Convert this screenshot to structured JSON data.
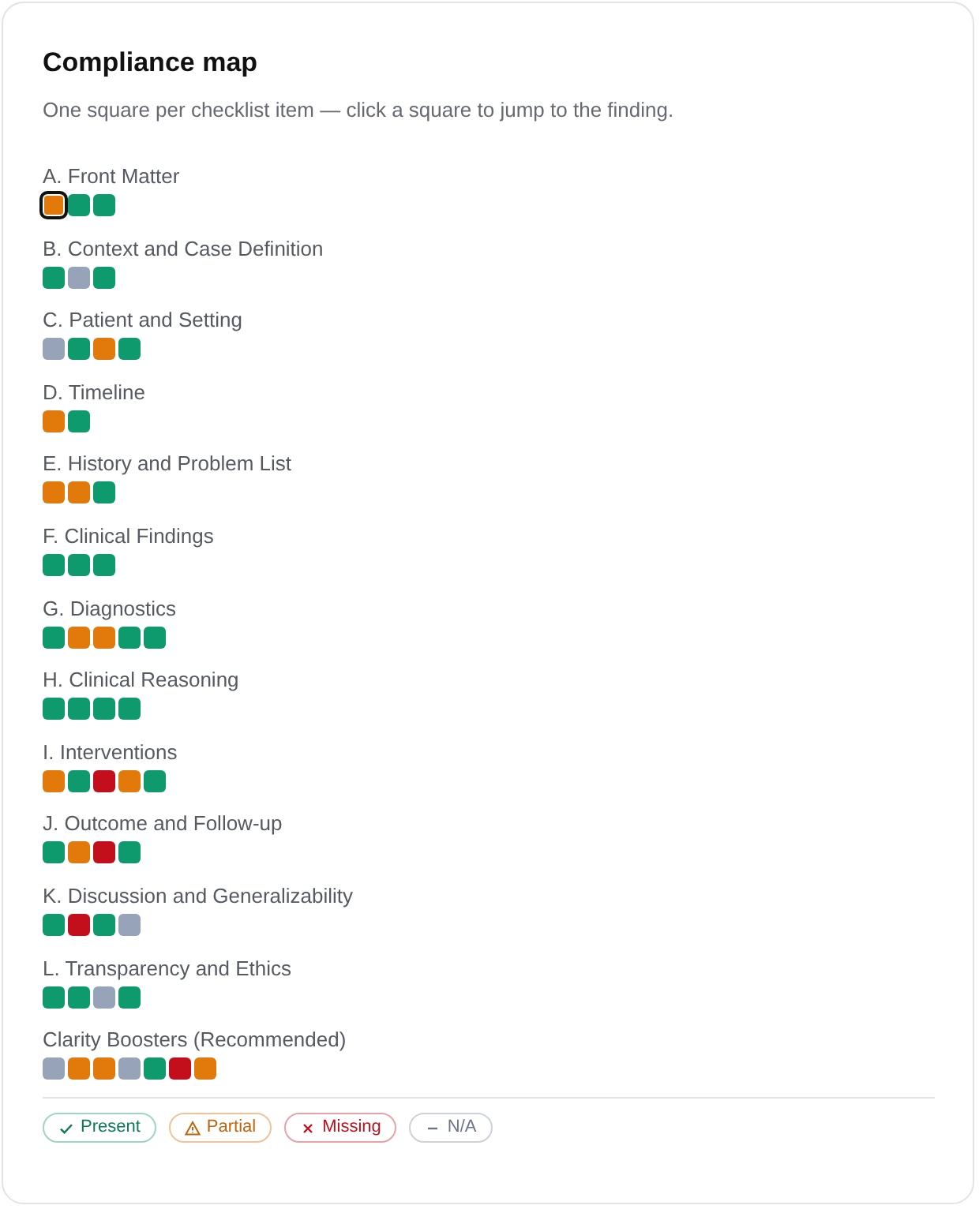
{
  "title": "Compliance map",
  "subtitle": "One square per checklist item — click a square to jump to the finding.",
  "sections": [
    {
      "label": "A. Front Matter",
      "squares": [
        {
          "kind": "partial",
          "selected": true
        },
        {
          "kind": "present",
          "selected": false
        },
        {
          "kind": "present",
          "selected": false
        }
      ]
    },
    {
      "label": "B. Context and Case Definition",
      "squares": [
        {
          "kind": "present",
          "selected": false
        },
        {
          "kind": "na",
          "selected": false
        },
        {
          "kind": "present",
          "selected": false
        }
      ]
    },
    {
      "label": "C. Patient and Setting",
      "squares": [
        {
          "kind": "na",
          "selected": false
        },
        {
          "kind": "present",
          "selected": false
        },
        {
          "kind": "partial",
          "selected": false
        },
        {
          "kind": "present",
          "selected": false
        }
      ]
    },
    {
      "label": "D. Timeline",
      "squares": [
        {
          "kind": "partial",
          "selected": false
        },
        {
          "kind": "present",
          "selected": false
        }
      ]
    },
    {
      "label": "E. History and Problem List",
      "squares": [
        {
          "kind": "partial",
          "selected": false
        },
        {
          "kind": "partial",
          "selected": false
        },
        {
          "kind": "present",
          "selected": false
        }
      ]
    },
    {
      "label": "F. Clinical Findings",
      "squares": [
        {
          "kind": "present",
          "selected": false
        },
        {
          "kind": "present",
          "selected": false
        },
        {
          "kind": "present",
          "selected": false
        }
      ]
    },
    {
      "label": "G. Diagnostics",
      "squares": [
        {
          "kind": "present",
          "selected": false
        },
        {
          "kind": "partial",
          "selected": false
        },
        {
          "kind": "partial",
          "selected": false
        },
        {
          "kind": "present",
          "selected": false
        },
        {
          "kind": "present",
          "selected": false
        }
      ]
    },
    {
      "label": "H. Clinical Reasoning",
      "squares": [
        {
          "kind": "present",
          "selected": false
        },
        {
          "kind": "present",
          "selected": false
        },
        {
          "kind": "present",
          "selected": false
        },
        {
          "kind": "present",
          "selected": false
        }
      ]
    },
    {
      "label": "I. Interventions",
      "squares": [
        {
          "kind": "partial",
          "selected": false
        },
        {
          "kind": "present",
          "selected": false
        },
        {
          "kind": "missing",
          "selected": false
        },
        {
          "kind": "partial",
          "selected": false
        },
        {
          "kind": "present",
          "selected": false
        }
      ]
    },
    {
      "label": "J. Outcome and Follow-up",
      "squares": [
        {
          "kind": "present",
          "selected": false
        },
        {
          "kind": "partial",
          "selected": false
        },
        {
          "kind": "missing",
          "selected": false
        },
        {
          "kind": "present",
          "selected": false
        }
      ]
    },
    {
      "label": "K. Discussion and Generalizability",
      "squares": [
        {
          "kind": "present",
          "selected": false
        },
        {
          "kind": "missing",
          "selected": false
        },
        {
          "kind": "present",
          "selected": false
        },
        {
          "kind": "na",
          "selected": false
        }
      ]
    },
    {
      "label": "L. Transparency and Ethics",
      "squares": [
        {
          "kind": "present",
          "selected": false
        },
        {
          "kind": "present",
          "selected": false
        },
        {
          "kind": "na",
          "selected": false
        },
        {
          "kind": "present",
          "selected": false
        }
      ]
    },
    {
      "label": "Clarity Boosters (Recommended)",
      "squares": [
        {
          "kind": "na",
          "selected": false
        },
        {
          "kind": "partial",
          "selected": false
        },
        {
          "kind": "partial",
          "selected": false
        },
        {
          "kind": "na",
          "selected": false
        },
        {
          "kind": "present",
          "selected": false
        },
        {
          "kind": "missing",
          "selected": false
        },
        {
          "kind": "partial",
          "selected": false
        }
      ]
    }
  ],
  "legend": [
    {
      "kind": "present",
      "label": "Present"
    },
    {
      "kind": "partial",
      "label": "Partial"
    },
    {
      "kind": "missing",
      "label": "Missing"
    },
    {
      "kind": "na",
      "label": "N/A"
    }
  ]
}
